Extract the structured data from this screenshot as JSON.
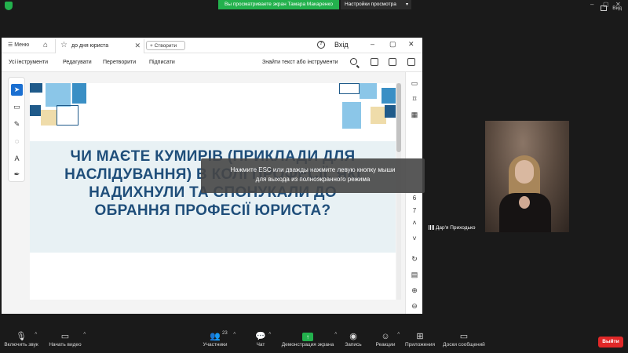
{
  "zoom_top": {
    "share_banner": "Вы просматриваете экран Тамара Макаренко",
    "view_options": "Настройки просмотра",
    "view_label": "Вид"
  },
  "acrobat": {
    "menu_label": "Меню",
    "tab_name": "до дня юриста",
    "create_label": "Створити",
    "login_label": "Вхід",
    "tools": [
      "Усі інструменти",
      "Редагувати",
      "Перетворити",
      "Підписати"
    ],
    "search_placeholder": "Знайти текст або інструменти",
    "page_numbers": [
      "6",
      "7"
    ]
  },
  "slide": {
    "heading": "ЧИ МАЄТЕ КУМИРІВ (ПРИКЛАДИ ДЛЯ НАСЛІДУВАННЯ) В КОЛІ ПРОФЕСІЇ, ЯКІ НАДИХНУЛИ ТА СПОНУКАЛИ ДО ОБРАННЯ ПРОФЕСІЇ ЮРИСТА?"
  },
  "esc_toast": {
    "line1": "Нажмите ESC или дважды нажмите левую кнопку мыши",
    "line2": "для выхода из полноэкранного режима"
  },
  "participant": {
    "name": "Дар'я Приходько"
  },
  "zoom_bottom": {
    "mute": "Включить звук",
    "video": "Начать видео",
    "participants": "Участники",
    "participants_count": "23",
    "chat": "Чат",
    "share": "Демонстрация экрана",
    "record": "Запись",
    "reactions": "Реакции",
    "apps": "Приложения",
    "whiteboards": "Доски сообщений",
    "leave": "Выйти"
  },
  "colors": {
    "zoom_green": "#23b14d",
    "slide_heading": "#1f4e7a",
    "leave_red": "#e02828",
    "acrobat_blue": "#1a6fd1"
  }
}
